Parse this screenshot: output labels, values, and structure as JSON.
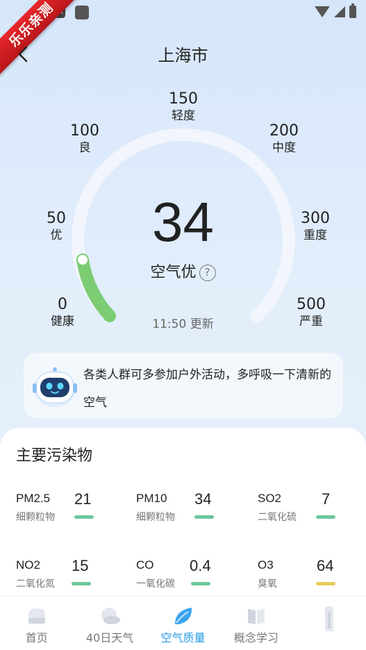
{
  "ribbon": {
    "text": "乐乐亲测"
  },
  "header": {
    "title": "上海市"
  },
  "gauge": {
    "scale": [
      {
        "value": "0",
        "label": "健康"
      },
      {
        "value": "50",
        "label": "优"
      },
      {
        "value": "100",
        "label": "良"
      },
      {
        "value": "150",
        "label": "轻度"
      },
      {
        "value": "200",
        "label": "中度"
      },
      {
        "value": "300",
        "label": "重度"
      },
      {
        "value": "500",
        "label": "严重"
      }
    ],
    "aqi": "34",
    "level": "空气优",
    "help": "?",
    "updated": "11:50 更新",
    "accent": "#7ccc74"
  },
  "advice": {
    "text": "各类人群可多参加户外活动，多呼吸一下清新的空气"
  },
  "pollutants": {
    "title": "主要污染物",
    "items": [
      {
        "name": "PM2.5",
        "sub": "细颗粒物",
        "value": "21",
        "color": "#6cc79c"
      },
      {
        "name": "PM10",
        "sub": "细颗粒物",
        "value": "34",
        "color": "#6cc79c"
      },
      {
        "name": "SO2",
        "sub": "二氧化硫",
        "value": "7",
        "color": "#6cc79c"
      },
      {
        "name": "NO2",
        "sub": "二氧化氮",
        "value": "15",
        "color": "#6cc79c"
      },
      {
        "name": "CO",
        "sub": "一氧化碳",
        "value": "0.4",
        "color": "#6cc79c"
      },
      {
        "name": "O3",
        "sub": "臭氧",
        "value": "64",
        "color": "#e8cc5a"
      }
    ]
  },
  "nav": {
    "items": [
      {
        "label": "首页",
        "icon": "home-icon"
      },
      {
        "label": "40日天气",
        "icon": "cloud-icon"
      },
      {
        "label": "空气质量",
        "icon": "leaf-icon",
        "active": true
      },
      {
        "label": "概念学习",
        "icon": "book-icon"
      },
      {
        "label": "",
        "icon": "building-icon"
      }
    ]
  }
}
